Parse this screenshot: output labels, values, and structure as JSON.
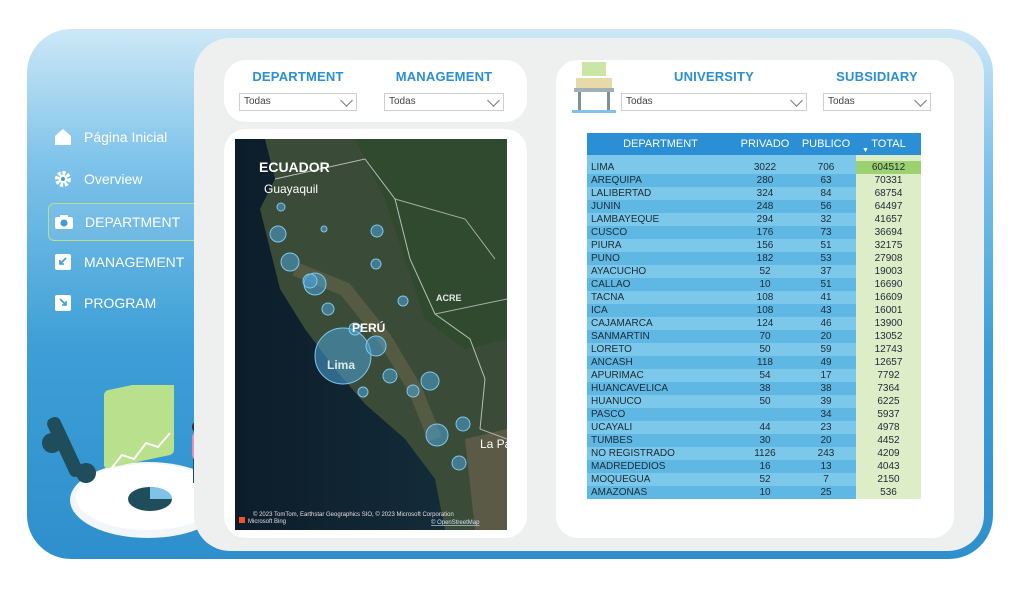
{
  "nav": {
    "items": [
      {
        "label": "Página Inicial",
        "icon": "home-icon"
      },
      {
        "label": "Overview",
        "icon": "gear-icon"
      },
      {
        "label": "DEPARTMENT",
        "icon": "camera-icon",
        "active": true
      },
      {
        "label": "MANAGEMENT",
        "icon": "arrow-down-left-icon"
      },
      {
        "label": "PROGRAM",
        "icon": "arrow-down-right-icon"
      }
    ]
  },
  "filters_left": {
    "department": {
      "label": "DEPARTMENT",
      "value": "Todas"
    },
    "management": {
      "label": "MANAGEMENT",
      "value": "Todas"
    }
  },
  "filters_right": {
    "university": {
      "label": "UNIVERSITY",
      "value": "Todas"
    },
    "subsidiary": {
      "label": "SUBSIDIARY",
      "value": "Todas"
    }
  },
  "map": {
    "labels": {
      "ecuador": "ECUADOR",
      "guayaquil": "Guayaquil",
      "peru": "PERÚ",
      "acre": "ACRE",
      "lima": "Lima",
      "lapaz": "La Pa"
    },
    "attribution": "© 2023 TomTom, Earthstar Geographics SIO, © 2023 Microsoft Corporation",
    "bing": "Microsoft Bing",
    "osm": "© OpenStreetMap"
  },
  "table": {
    "headers": {
      "department": "DEPARTMENT",
      "privado": "PRIVADO",
      "publico": "PUBLICO",
      "total": "TOTAL"
    },
    "rows": [
      {
        "department": "LIMA",
        "privado": "3022",
        "publico": "706",
        "total": "604512"
      },
      {
        "department": "AREQUIPA",
        "privado": "280",
        "publico": "63",
        "total": "70331"
      },
      {
        "department": "LALIBERTAD",
        "privado": "324",
        "publico": "84",
        "total": "68754"
      },
      {
        "department": "JUNIN",
        "privado": "248",
        "publico": "56",
        "total": "64497"
      },
      {
        "department": "LAMBAYEQUE",
        "privado": "294",
        "publico": "32",
        "total": "41657"
      },
      {
        "department": "CUSCO",
        "privado": "176",
        "publico": "73",
        "total": "36694"
      },
      {
        "department": "PIURA",
        "privado": "156",
        "publico": "51",
        "total": "32175"
      },
      {
        "department": "PUNO",
        "privado": "182",
        "publico": "53",
        "total": "27908"
      },
      {
        "department": "AYACUCHO",
        "privado": "52",
        "publico": "37",
        "total": "19003"
      },
      {
        "department": "CALLAO",
        "privado": "10",
        "publico": "51",
        "total": "16690"
      },
      {
        "department": "TACNA",
        "privado": "108",
        "publico": "41",
        "total": "16609"
      },
      {
        "department": "ICA",
        "privado": "108",
        "publico": "43",
        "total": "16001"
      },
      {
        "department": "CAJAMARCA",
        "privado": "124",
        "publico": "46",
        "total": "13900"
      },
      {
        "department": "SANMARTIN",
        "privado": "70",
        "publico": "20",
        "total": "13052"
      },
      {
        "department": "LORETO",
        "privado": "50",
        "publico": "59",
        "total": "12743"
      },
      {
        "department": "ANCASH",
        "privado": "118",
        "publico": "49",
        "total": "12657"
      },
      {
        "department": "APURIMAC",
        "privado": "54",
        "publico": "17",
        "total": "7792"
      },
      {
        "department": "HUANCAVELICA",
        "privado": "38",
        "publico": "38",
        "total": "7364"
      },
      {
        "department": "HUANUCO",
        "privado": "50",
        "publico": "39",
        "total": "6225"
      },
      {
        "department": "PASCO",
        "privado": "",
        "publico": "34",
        "total": "5937"
      },
      {
        "department": "UCAYALI",
        "privado": "44",
        "publico": "23",
        "total": "4978"
      },
      {
        "department": "TUMBES",
        "privado": "30",
        "publico": "20",
        "total": "4452"
      },
      {
        "department": "NO REGISTRADO",
        "privado": "1126",
        "publico": "243",
        "total": "4209"
      },
      {
        "department": "MADREDEDIOS",
        "privado": "16",
        "publico": "13",
        "total": "4043"
      },
      {
        "department": "MOQUEGUA",
        "privado": "52",
        "publico": "7",
        "total": "2150"
      },
      {
        "department": "AMAZONAS",
        "privado": "10",
        "publico": "25",
        "total": "536"
      }
    ]
  },
  "colors": {
    "accent": "#2a8fd4",
    "highlight": "#9bd16f",
    "total_bg": "#dcedc8"
  }
}
